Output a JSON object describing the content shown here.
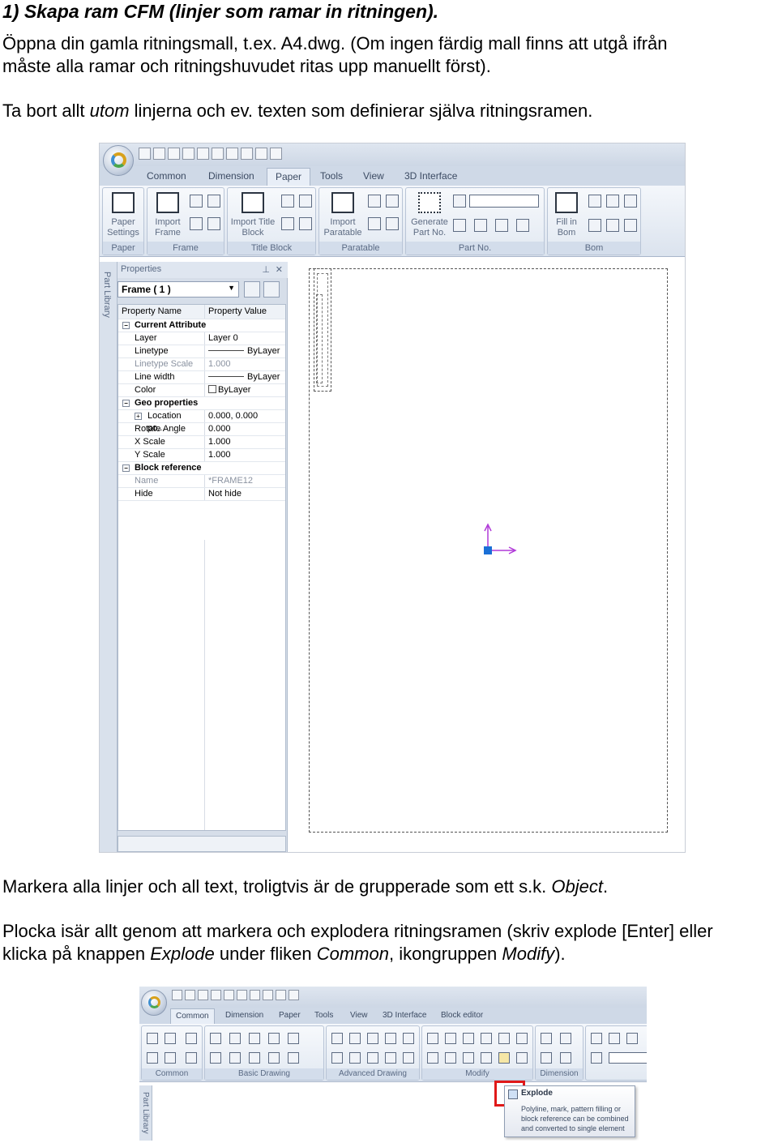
{
  "heading": "1) Skapa ram CFM (linjer som ramar in ritningen).",
  "para1": {
    "line1": "Öppna din gamla ritningsmall, t.ex. A4.dwg. (Om ingen färdig mall finns att utgå ifrån",
    "line2": "måste alla ramar och ritningshuvudet ritas upp manuellt först)."
  },
  "para2": {
    "before": "Ta bort allt ",
    "em": "utom",
    "after": " linjerna och ev. texten som definierar själva ritningsramen."
  },
  "para3": {
    "before": "Markera alla linjer och all text, troligtvis är de grupperade som ett s.k. ",
    "em": "Object",
    "after": "."
  },
  "para4": {
    "line1": "Plocka isär allt genom att markera och explodera ritningsramen (skriv explode [Enter] eller",
    "l2_a": "klicka på knappen ",
    "l2_em1": "Explode",
    "l2_b": " under fliken ",
    "l2_em2": "Common",
    "l2_c": ", ikongruppen ",
    "l2_em3": "Modify",
    "l2_d": ")."
  },
  "shot1": {
    "tabs": [
      "Common",
      "Dimension",
      "Paper",
      "Tools",
      "View",
      "3D Interface"
    ],
    "active_tab": "Paper",
    "groups": {
      "paper": "Paper",
      "frame": "Frame",
      "title_block": "Title Block",
      "paratable": "Paratable",
      "part_no": "Part No.",
      "bom": "Bom"
    },
    "buttons": {
      "paper_settings": "Paper Settings",
      "import_frame": "Import Frame",
      "import_title_block": "Import Title Block",
      "import_paratable": "Import Paratable",
      "generate_part_no": "Generate Part No.",
      "fill_in_bom": "Fill in Bom"
    },
    "part_library": "Part Library",
    "properties": {
      "title": "Properties",
      "selector": "Frame ( 1 )",
      "col_name": "Property Name",
      "col_value": "Property Value",
      "current_attribute": "Current Attribute",
      "layer_label": "Layer",
      "layer_value": "Layer 0",
      "linetype_label": "Linetype",
      "linetype_value": "ByLayer",
      "linetype_scale_label": "Linetype Scale",
      "linetype_scale_value": "1.000",
      "line_width_label": "Line width",
      "line_width_value": "ByLayer",
      "color_label": "Color",
      "color_value": "ByLayer",
      "geo_properties": "Geo properties",
      "location_label": "Location po...",
      "location_value": "0.000, 0.000",
      "rotate_label": "Rotate Angle",
      "rotate_value": "0.000",
      "xscale_label": "X Scale",
      "xscale_value": "1.000",
      "yscale_label": "Y Scale",
      "yscale_value": "1.000",
      "block_reference": "Block reference",
      "name_label": "Name",
      "name_value": "*FRAME12",
      "hide_label": "Hide",
      "hide_value": "Not hide"
    }
  },
  "shot2": {
    "tabs": [
      "Common",
      "Dimension",
      "Paper",
      "Tools",
      "View",
      "3D Interface",
      "Block editor"
    ],
    "active_tab": "Common",
    "groups": {
      "common": "Common",
      "basic_drawing": "Basic Drawing",
      "advanced_drawing": "Advanced Drawing",
      "modify": "Modify",
      "dimension": "Dimension"
    },
    "part_library": "Part Library",
    "tooltip_title": "Explode",
    "tooltip_body": "Polyline, mark, pattern filling or block reference can be combined and converted to single element"
  },
  "colors": {
    "highlight_box": "#e01919",
    "ucs_arrow": "#b13ad8",
    "ucs_origin": "#1a6fd6"
  }
}
